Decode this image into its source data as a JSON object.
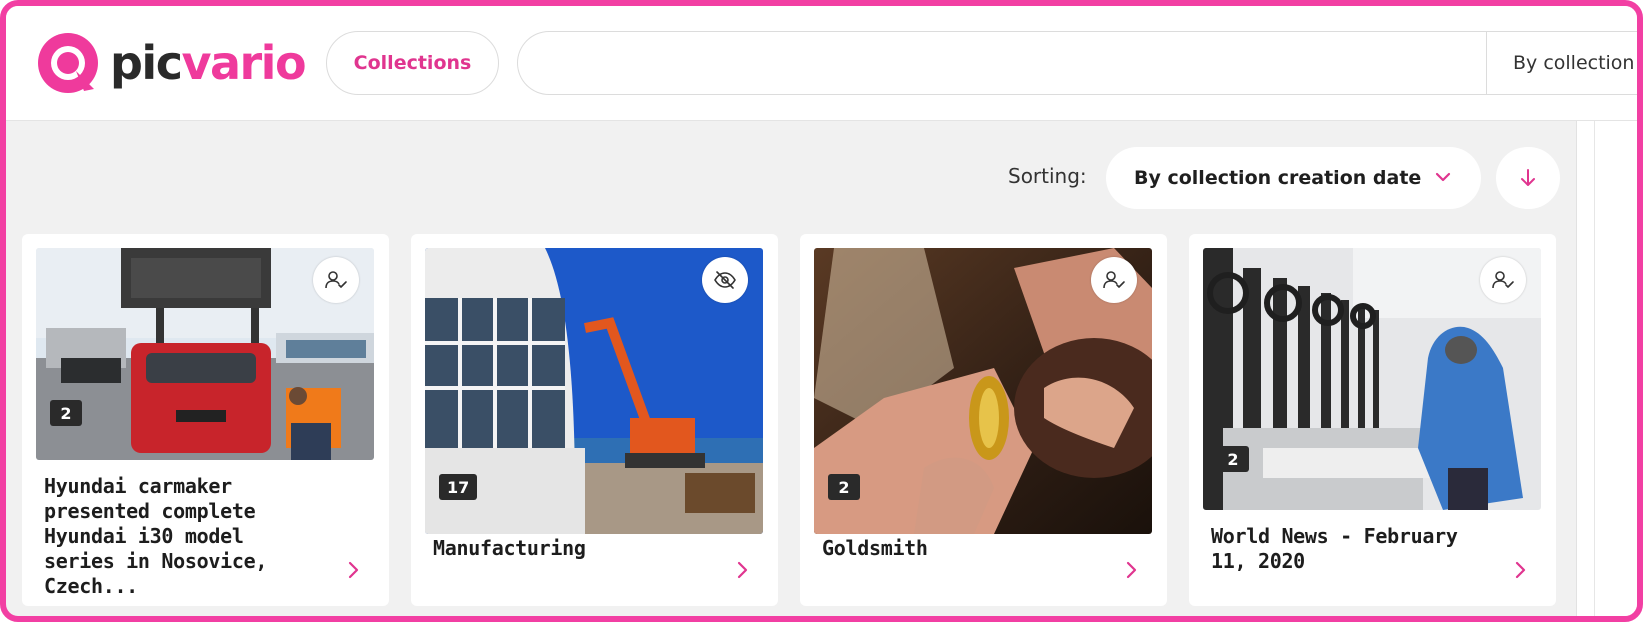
{
  "brand": {
    "name_part1": "pic",
    "name_part2": "vario",
    "accent": "#ef3a9c"
  },
  "header": {
    "collections_label": "Collections",
    "search_value": "",
    "search_scope_label": "By collection"
  },
  "sorting": {
    "label": "Sorting:",
    "selected": "By collection creation date",
    "direction_icon": "arrow-down-icon"
  },
  "cards": [
    {
      "title": "Hyundai carmaker presented complete Hyundai i30 model series in Nosovice, Czech...",
      "count": "2",
      "state_icon": "user-check-icon"
    },
    {
      "title": "Manufacturing",
      "count": "17",
      "state_icon": "eye-off-icon"
    },
    {
      "title": "Goldsmith",
      "count": "2",
      "state_icon": "user-check-icon"
    },
    {
      "title": "World News - February 11, 2020",
      "count": "2",
      "state_icon": "user-check-icon"
    }
  ]
}
